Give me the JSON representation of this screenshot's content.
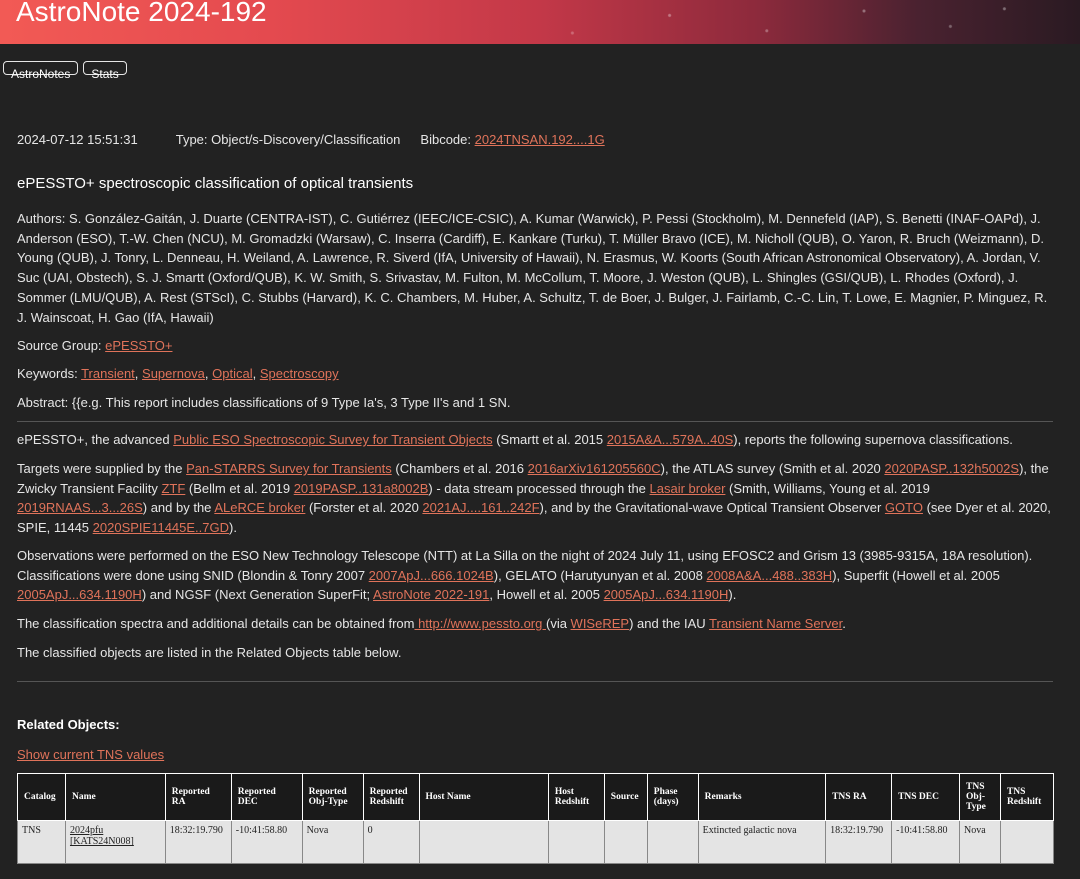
{
  "header": {
    "title": "AstroNote 2024-192"
  },
  "nav": {
    "astronotes_label": "AstroNotes",
    "stats_label": "Stats"
  },
  "meta": {
    "date": "2024-07-12 15:51:31",
    "type_label": "Type: Object/s-Discovery/Classification",
    "bibcode_label": "Bibcode: ",
    "bibcode": "2024TNSAN.192....1G"
  },
  "title": "ePESSTO+ spectroscopic classification of optical transients",
  "authors": "Authors: S. González-Gaitán, J. Duarte (CENTRA-IST), C. Gutiérrez (IEEC/ICE-CSIC), A. Kumar (Warwick), P. Pessi (Stockholm), M. Dennefeld (IAP), S. Benetti (INAF-OAPd), J. Anderson (ESO), T.-W. Chen (NCU), M. Gromadzki (Warsaw), C. Inserra (Cardiff), E. Kankare (Turku), T. Müller Bravo (ICE), M. Nicholl (QUB), O. Yaron, R. Bruch (Weizmann), D. Young (QUB), J. Tonry, L. Denneau, H. Weiland, A. Lawrence, R. Siverd (IfA, University of Hawaii), N. Erasmus, W. Koorts (South African Astronomical Observatory), A. Jordan, V. Suc (UAI, Obstech), S. J. Smartt (Oxford/QUB), K. W. Smith, S. Srivastav, M. Fulton, M. McCollum, T. Moore, J. Weston (QUB), L. Shingles (GSI/QUB), L. Rhodes (Oxford), J. Sommer (LMU/QUB), A. Rest (STScI), C. Stubbs (Harvard), K. C. Chambers, M. Huber, A. Schultz, T. de Boer, J. Bulger, J. Fairlamb, C.-C. Lin, T. Lowe, E. Magnier, P. Minguez, R. J. Wainscoat, H. Gao (IfA, Hawaii)",
  "source_group": {
    "label": "Source Group: ",
    "value": "ePESSTO+"
  },
  "keywords": {
    "label": "Keywords: ",
    "items": [
      "Transient",
      "Supernova",
      "Optical",
      "Spectroscopy"
    ],
    "sep": ", "
  },
  "abstract": "Abstract: {{e.g. This report includes classifications of 9 Type Ia's, 3 Type II's and 1 SN.",
  "p1": {
    "t1": "ePESSTO+, the advanced ",
    "l1": "Public ESO Spectroscopic Survey for Transient Objects",
    "t2": " (Smartt et al. 2015 ",
    "l2": "2015A&A...579A..40S",
    "t3": "), reports the following supernova classifications."
  },
  "p2": {
    "t1": "Targets were supplied by the ",
    "l1": "Pan-STARRS Survey for Transients",
    "t2": " (Chambers et al. 2016 ",
    "l2": "2016arXiv161205560C",
    "t3": "), the ATLAS survey (Smith et al. 2020 ",
    "l3": "2020PASP..132h5002S",
    "t4": "), the Zwicky Transient Facility ",
    "l4": "ZTF",
    "t5": " (Bellm et al. 2019 ",
    "l5": "2019PASP..131a8002B",
    "t6": ") - data stream processed through the ",
    "l6": "Lasair broker",
    "t7": " (Smith, Williams, Young et al. 2019 ",
    "l7": "2019RNAAS...3...26S",
    "t8": ") and by the ",
    "l8": "ALeRCE broker",
    "t9": " (Forster et al. 2020 ",
    "l9": "2021AJ....161..242F",
    "t10": "), and by the Gravitational-wave Optical Transient Observer ",
    "l10": "GOTO",
    "t11": " (see Dyer et al. 2020, SPIE, 11445 ",
    "l11": "2020SPIE11445E..7GD",
    "t12": ")."
  },
  "p3": {
    "t1": "Observations were performed on the ESO New Technology Telescope (NTT) at La Silla on the night of 2024 July 11, using EFOSC2 and Grism 13 (3985-9315A, 18A resolution). Classifications were done using SNID (Blondin & Tonry 2007 ",
    "l1": "2007ApJ...666.1024B",
    "t2": "), GELATO (Harutyunyan et al. 2008 ",
    "l2": "2008A&A...488..383H",
    "t3": "), Superfit (Howell et al. 2005 ",
    "l3": "2005ApJ...634.1190H",
    "t4": ") and NGSF (Next Generation SuperFit; ",
    "l4": "AstroNote 2022-191",
    "t5": ", Howell et al. 2005 ",
    "l5": "2005ApJ...634.1190H",
    "t6": ")."
  },
  "p4": {
    "t1": "The classification spectra and additional details can be obtained from",
    "l1": " http://www.pessto.org ",
    "t2": "(via ",
    "l2": "WISeREP",
    "t3": ") and the IAU ",
    "l3": "Transient Name Server",
    "t4": "."
  },
  "p5": "The classified objects are listed in the Related Objects table below.",
  "related": {
    "title": "Related Objects:",
    "show_tns": "Show current TNS values",
    "headers": [
      "Catalog",
      "Name",
      "Reported RA",
      "Reported DEC",
      "Reported Obj-Type",
      "Reported Redshift",
      "Host Name",
      "Host Redshift",
      "Source",
      "Phase (days)",
      "Remarks",
      "TNS RA",
      "TNS DEC",
      "TNS Obj-Type",
      "TNS Redshift"
    ],
    "row": {
      "catalog": "TNS",
      "name": "2024pfu",
      "name_alt": "[KATS24N008]",
      "ra": "18:32:19.790",
      "dec": "-10:41:58.80",
      "objtype": "Nova",
      "redshift": "0",
      "host_name": "",
      "host_redshift": "",
      "source": "",
      "phase": "",
      "remarks": "Extincted galactic nova",
      "tns_ra": "18:32:19.790",
      "tns_dec": "-10:41:58.80",
      "tns_objtype": "Nova",
      "tns_redshift": ""
    }
  }
}
